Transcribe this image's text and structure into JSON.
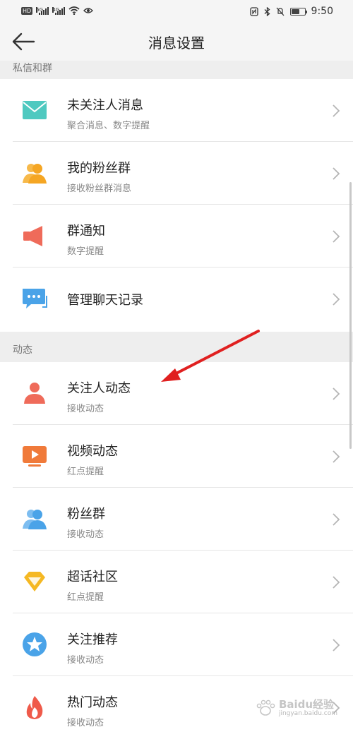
{
  "status_bar": {
    "hd_badge": "HD",
    "net_1": "5G",
    "net_2": "4G",
    "time": "9:50",
    "battery_level": 0.6
  },
  "header": {
    "title": "消息设置"
  },
  "sections": [
    {
      "title": "私信和群",
      "items": [
        {
          "icon": "envelope-icon",
          "label": "未关注人消息",
          "sub": "聚合消息、数字提醒",
          "color": "#4fc9c0"
        },
        {
          "icon": "fan-group-icon",
          "label": "我的粉丝群",
          "sub": "接收粉丝群消息",
          "color": "#f5a623"
        },
        {
          "icon": "megaphone-icon",
          "label": "群通知",
          "sub": "数字提醒",
          "color": "#ef6b5a"
        },
        {
          "icon": "chat-history-icon",
          "label": "管理聊天记录",
          "sub": "",
          "color": "#4aa3e8"
        }
      ]
    },
    {
      "title": "动态",
      "items": [
        {
          "icon": "person-icon",
          "label": "关注人动态",
          "sub": "接收动态",
          "color": "#ef6b5a"
        },
        {
          "icon": "video-icon",
          "label": "视频动态",
          "sub": "红点提醒",
          "color": "#f07a3a"
        },
        {
          "icon": "fans-icon",
          "label": "粉丝群",
          "sub": "接收动态",
          "color": "#4aa3e8"
        },
        {
          "icon": "diamond-icon",
          "label": "超话社区",
          "sub": "红点提醒",
          "color": "#f5b823"
        },
        {
          "icon": "star-icon",
          "label": "关注推荐",
          "sub": "接收动态",
          "color": "#4aa3e8"
        },
        {
          "icon": "flame-icon",
          "label": "热门动态",
          "sub": "接收动态",
          "color": "#ef5a4a"
        }
      ]
    }
  ],
  "watermark": {
    "brand": "Baidu经验",
    "url": "jingyan.baidu.com"
  },
  "colors": {
    "annotation_arrow": "#e02020",
    "chevron": "#b5b5b5"
  }
}
